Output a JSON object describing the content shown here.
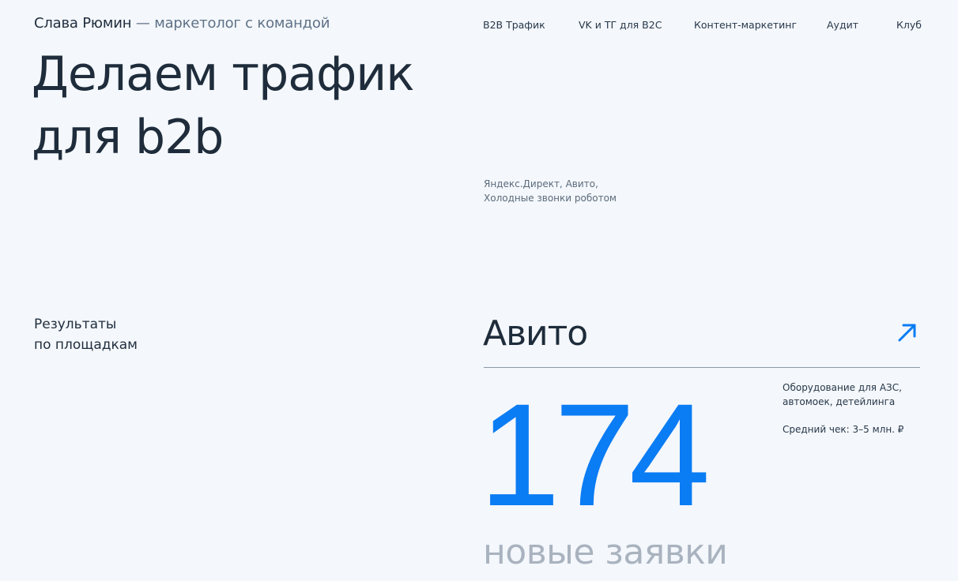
{
  "header": {
    "name": "Слава Рюмин",
    "separator": "—",
    "role": "маркетолог с командой"
  },
  "nav": {
    "items": [
      "B2B Трафик",
      "VK и ТГ для B2C",
      "Контент-маркетинг",
      "Аудит",
      "Клуб"
    ]
  },
  "hero": {
    "line1": "Делаем трафик",
    "line2": "для b2b",
    "channels_line1": "Яндекс.Директ, Авито,",
    "channels_line2": "Холодные звонки роботом"
  },
  "results": {
    "label_line1": "Результаты",
    "label_line2": "по площадкам",
    "platform": "Авито",
    "arrow_icon": "arrow-up-right-icon",
    "value": "174",
    "metric": "новые заявки",
    "desc_line1": "Оборудование для АЗС,",
    "desc_line2": "автомоек, детейлинга",
    "avg_check": "Средний чек: 3–5 млн. ₽"
  },
  "colors": {
    "background": "#f4f7fb",
    "text": "#1f2d3d",
    "accent": "#0a7cf4",
    "muted": "#a9b3bf"
  }
}
